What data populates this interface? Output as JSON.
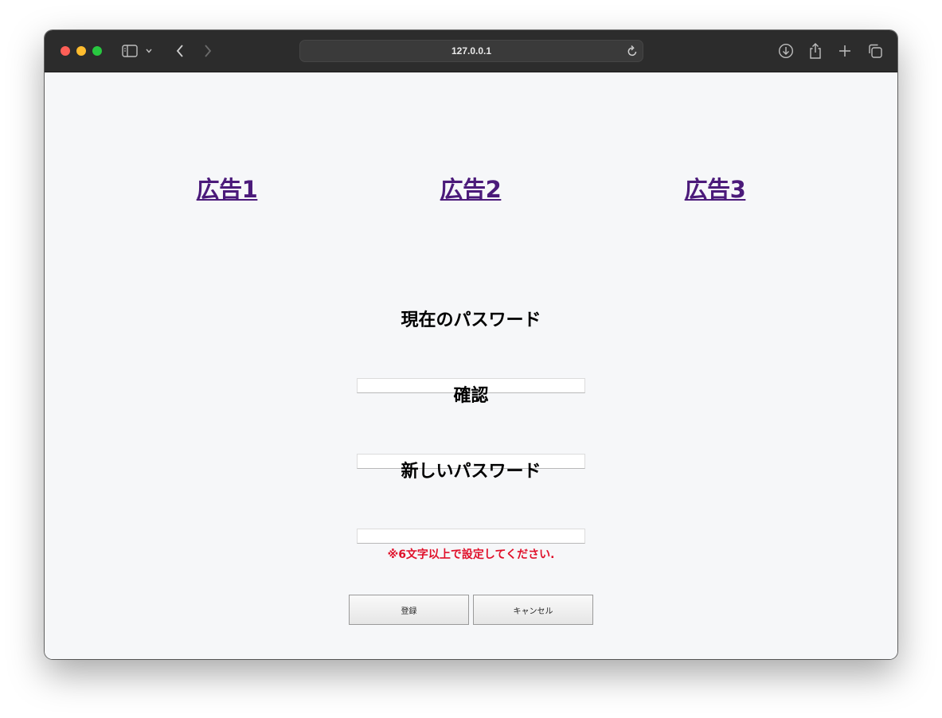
{
  "browser": {
    "url": "127.0.0.1",
    "icons": [
      "sidebar-icon",
      "chevron-down-icon",
      "back-icon",
      "forward-icon",
      "reload-icon",
      "download-icon",
      "share-icon",
      "new-tab-icon",
      "tabs-overview-icon"
    ]
  },
  "ads": [
    "広告1",
    "広告2",
    "広告3"
  ],
  "form": {
    "current_password_label": "現在のパスワード",
    "confirm_label": "確認",
    "new_password_label": "新しいパスワード",
    "current_password_value": "",
    "confirm_value": "",
    "new_password_value": "",
    "hint": "※6文字以上で設定してください."
  },
  "buttons": {
    "register": "登録",
    "cancel": "キャンセル"
  },
  "colors": {
    "link": "#4b1a7a",
    "hint": "#e0102a",
    "page_background": "#f6f7f9"
  }
}
